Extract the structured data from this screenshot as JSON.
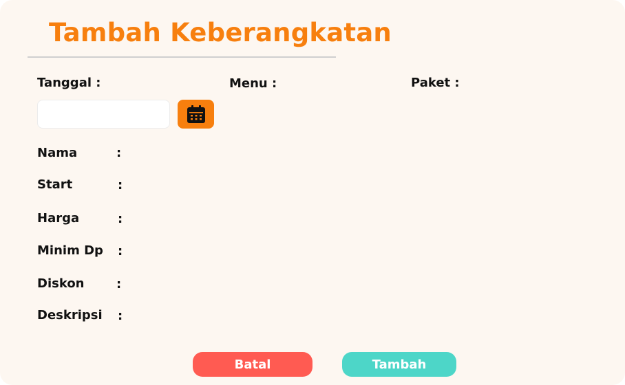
{
  "title": "Tambah Keberangkatan",
  "fields": {
    "tanggal_label": "Tanggal :",
    "menu_label": "Menu :",
    "paket_label": "Paket :",
    "tanggal_value": "",
    "nama_label": "Nama",
    "start_label": "Start",
    "harga_label": "Harga",
    "minim_dp_label": "Minim Dp",
    "diskon_label": "Diskon",
    "deskripsi_label": "Deskripsi",
    "colon": ":"
  },
  "buttons": {
    "cancel_label": "Batal",
    "submit_label": "Tambah"
  },
  "icons": {
    "calendar": "calendar-icon"
  },
  "colors": {
    "accent": "#f77f0e",
    "background": "#fdf7f1",
    "cancel": "#ff5b52",
    "submit": "#4dd6c8"
  }
}
